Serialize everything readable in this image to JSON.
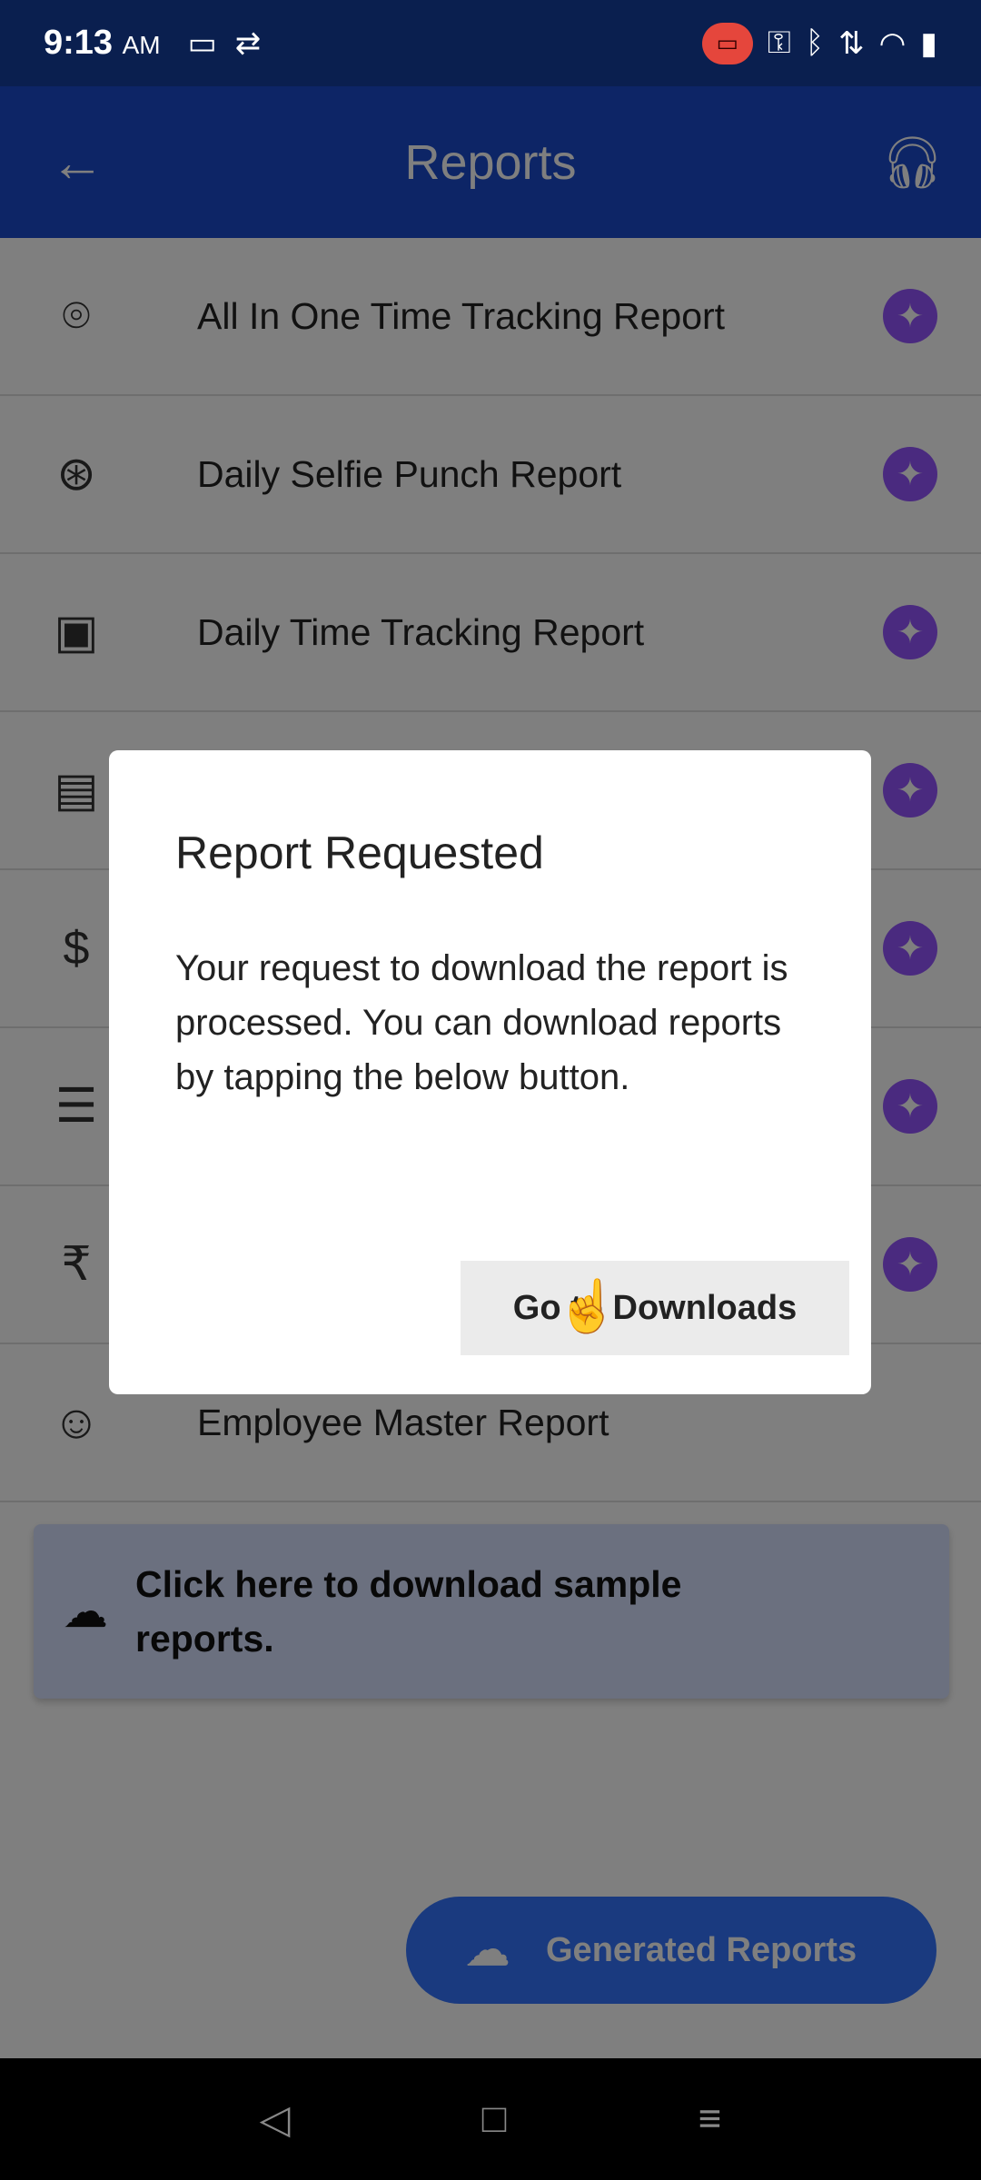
{
  "status_bar": {
    "time": "9:13",
    "ampm": "AM"
  },
  "header": {
    "title": "Reports"
  },
  "reports": [
    {
      "label": "All In One Time Tracking Report",
      "icon": "location-pin-icon"
    },
    {
      "label": "Daily Selfie Punch Report",
      "icon": "camera-shutter-icon"
    },
    {
      "label": "Daily Time Tracking Report",
      "icon": "calendar-icon"
    },
    {
      "label": "",
      "icon": "calendar-month-icon"
    },
    {
      "label": "",
      "icon": "dollar-icon"
    },
    {
      "label": "",
      "icon": "document-clock-icon"
    },
    {
      "label": "",
      "icon": "rupee-download-icon"
    },
    {
      "label": "Employee Master Report",
      "icon": "employee-icon"
    }
  ],
  "sample": {
    "text": "Click here to download sample reports."
  },
  "generated_button": {
    "label": "Generated Reports"
  },
  "dialog": {
    "title": "Report Requested",
    "body": "Your request to download the report is processed. You can download reports by tapping the below button.",
    "button": "Go to Downloads"
  },
  "colors": {
    "header": "#1a4bcc",
    "accent": "#3474ff",
    "badge": "#9455ff"
  }
}
